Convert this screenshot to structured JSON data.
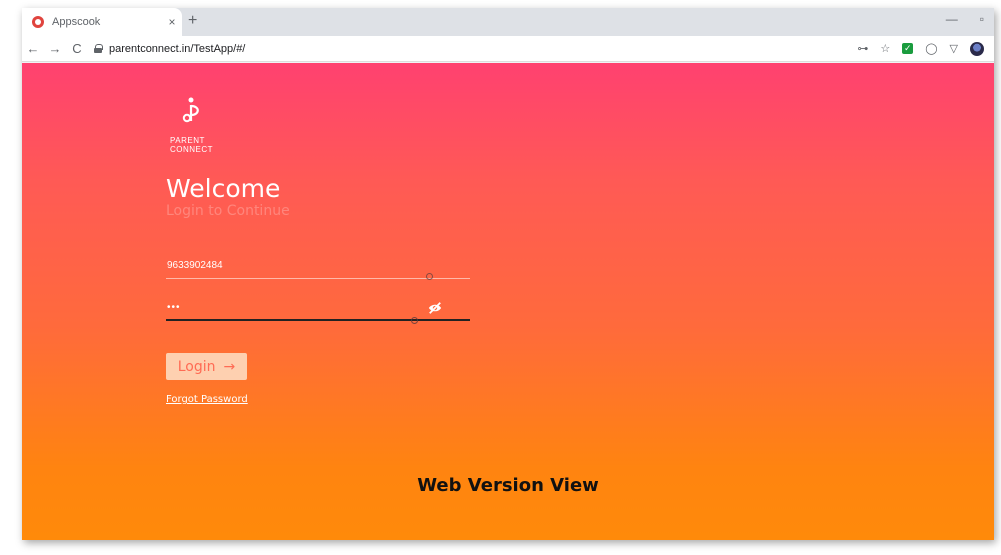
{
  "browser": {
    "tab_title": "Appscook",
    "tab_close": "×",
    "new_tab": "+",
    "window_minimize": "—",
    "window_maximize": "▫",
    "nav_back": "←",
    "nav_forward": "→",
    "nav_reload": "C",
    "url": "parentconnect.in/TestApp/#/",
    "key_icon": "⊶",
    "star_icon": "☆",
    "ext_check": "✓",
    "ext_circle": "◯",
    "ext_shield": "▽"
  },
  "login": {
    "logo_text": "PARENT CONNECT",
    "welcome": "Welcome",
    "subtitle": "Login to Continue",
    "phone_value": "9633902484",
    "password_value": "•••",
    "login_label": "Login",
    "login_arrow": "→",
    "forgot_password": "Forgot Password"
  },
  "caption": "Web Version View",
  "colors": {
    "gradient_top": "#ff4170",
    "gradient_bottom": "#ff8a0a",
    "login_button_bg": "#fed0b0"
  }
}
